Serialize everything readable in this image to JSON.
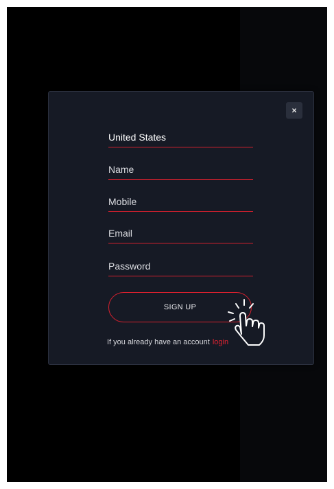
{
  "modal": {
    "close_icon": "×",
    "fields": [
      {
        "name": "country-field",
        "label": "United States"
      },
      {
        "name": "name-field",
        "label": "Name"
      },
      {
        "name": "mobile-field",
        "label": "Mobile"
      },
      {
        "name": "email-field",
        "label": "Email"
      },
      {
        "name": "password-field",
        "label": "Password"
      }
    ],
    "signup_label": "SIGN UP",
    "account_text": "If you already have an account",
    "login_label": "login"
  },
  "colors": {
    "accent": "#d8202e",
    "modal_bg": "#161a25",
    "overlay": "#000000"
  },
  "icons": {
    "pointer": "hand-pointer-click-icon"
  }
}
